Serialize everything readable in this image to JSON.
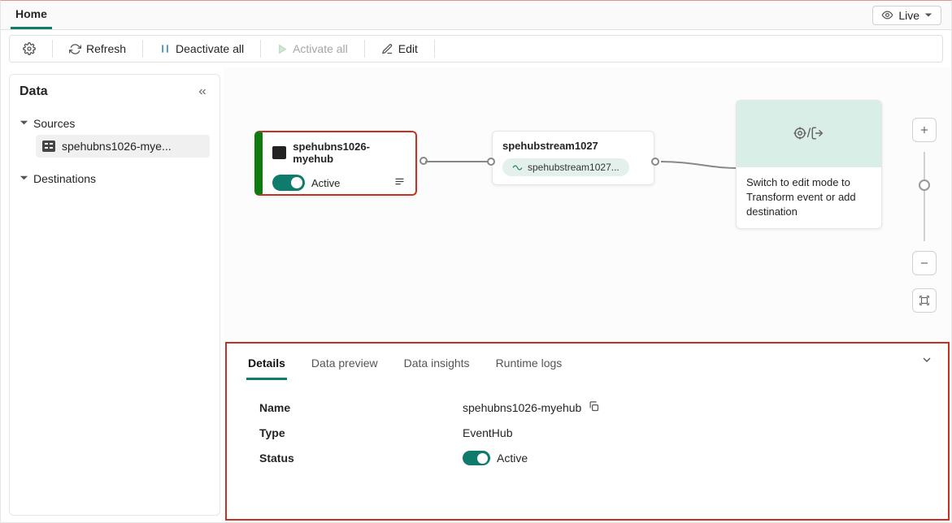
{
  "topbar": {
    "tab": "Home",
    "live_label": "Live"
  },
  "toolbar": {
    "refresh": "Refresh",
    "deactivate": "Deactivate all",
    "activate": "Activate all",
    "edit": "Edit"
  },
  "sidebar": {
    "title": "Data",
    "sources_label": "Sources",
    "source_item": "spehubns1026-mye...",
    "destinations_label": "Destinations"
  },
  "canvas": {
    "source_node": {
      "title": "spehubns1026-myehub",
      "status": "Active"
    },
    "stream_node": {
      "title": "spehubstream1027",
      "pill": "spehubstream1027..."
    },
    "dest_hint": "Switch to edit mode to Transform event or add destination",
    "dest_sep": " / "
  },
  "details": {
    "tabs": {
      "details": "Details",
      "preview": "Data preview",
      "insights": "Data insights",
      "logs": "Runtime logs"
    },
    "name_label": "Name",
    "name_value": "spehubns1026-myehub",
    "type_label": "Type",
    "type_value": "EventHub",
    "status_label": "Status",
    "status_value": "Active"
  }
}
